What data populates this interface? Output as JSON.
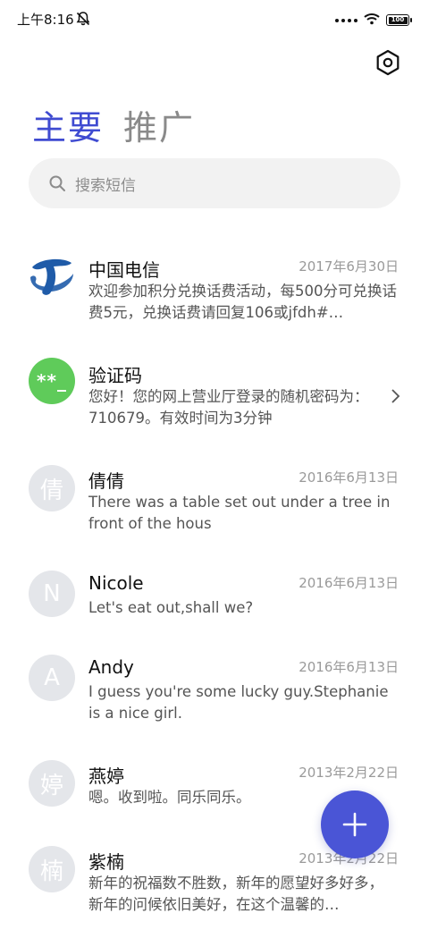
{
  "status_bar": {
    "time": "上午8:16",
    "battery_level": "100"
  },
  "tabs": [
    {
      "label": "主要",
      "active": true
    },
    {
      "label": "推广",
      "active": false
    }
  ],
  "search": {
    "placeholder": "搜索短信"
  },
  "conversations": [
    {
      "name": "中国电信",
      "date": "2017年6月30日",
      "preview": "欢迎参加积分兑换话费活动，每500分可兑换话费5元，兑换话费请回复106或jfdh#…",
      "avatar": "china-telecom-logo"
    },
    {
      "name": "验证码",
      "date": "",
      "preview": "您好！您的网上营业厅登录的随机密码为：710679。有效时间为3分钟",
      "avatar_text": "**_"
    },
    {
      "name": "倩倩",
      "date": "2016年6月13日",
      "preview": "There was a table set out under a tree in front of the hous",
      "avatar_text": "倩"
    },
    {
      "name": "Nicole",
      "date": "2016年6月13日",
      "preview": "Let's eat out,shall we?",
      "avatar_text": "N"
    },
    {
      "name": "Andy",
      "date": "2016年6月13日",
      "preview": "I guess you're some lucky guy.Stephanie is a nice girl.",
      "avatar_text": "A"
    },
    {
      "name": "燕婷",
      "date": "2013年2月22日",
      "preview": "嗯。收到啦。同乐同乐。",
      "avatar_text": "婷"
    },
    {
      "name": "紫楠",
      "date": "2013年2月22日",
      "preview": "新年的祝福数不胜数，新年的愿望好多好多，新年的问候依旧美好，在这个温馨的…",
      "avatar_text": "楠"
    }
  ],
  "colors": {
    "accent": "#3f4bd1",
    "fab": "#4a55d6",
    "verify_avatar": "#5fcb5a",
    "telecom_blue": "#1f5ba8"
  }
}
